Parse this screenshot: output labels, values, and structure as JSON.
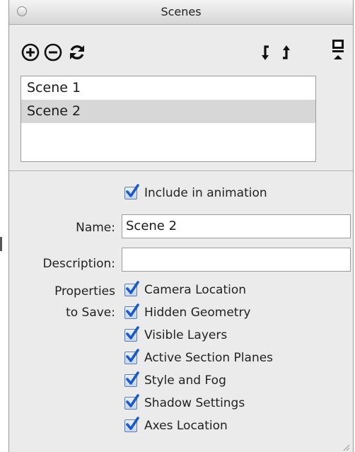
{
  "window": {
    "title": "Scenes"
  },
  "toolbar": {
    "add_icon": "plus-circle-icon",
    "remove_icon": "minus-circle-icon",
    "update_icon": "refresh-icon",
    "move_down_icon": "arrow-down-icon",
    "move_up_icon": "arrow-up-icon",
    "details_icon": "panel-toggle-icon"
  },
  "scenes": [
    {
      "label": "Scene 1",
      "selected": false
    },
    {
      "label": "Scene 2",
      "selected": true
    }
  ],
  "include_in_animation": {
    "label": "Include in animation",
    "checked": true
  },
  "name_field": {
    "label": "Name:",
    "value": "Scene 2"
  },
  "description_field": {
    "label": "Description:",
    "value": ""
  },
  "properties": {
    "label_line1": "Properties",
    "label_line2": "to Save:",
    "items": [
      {
        "label": "Camera Location",
        "checked": true
      },
      {
        "label": "Hidden Geometry",
        "checked": true
      },
      {
        "label": "Visible Layers",
        "checked": true
      },
      {
        "label": "Active Section Planes",
        "checked": true
      },
      {
        "label": "Style and Fog",
        "checked": true
      },
      {
        "label": "Shadow Settings",
        "checked": true
      },
      {
        "label": "Axes Location",
        "checked": true
      }
    ]
  },
  "colors": {
    "checkmark": "#1f57c9",
    "selection": "#d7d7d7",
    "panel_bg": "#ebebeb"
  }
}
